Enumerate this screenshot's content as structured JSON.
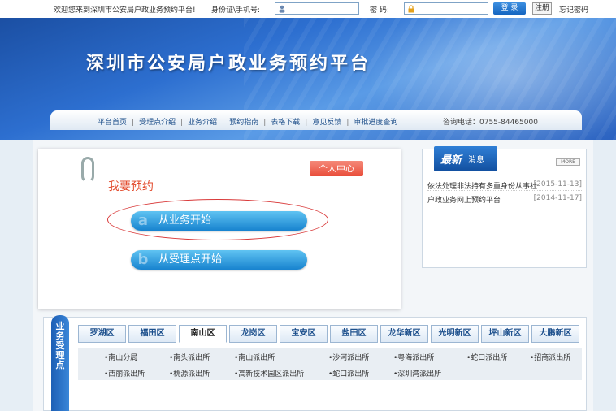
{
  "topbar": {
    "welcome": "欢迎您来到深圳市公安局户政业务预约平台!",
    "id_label": "身份证\\手机号:",
    "id_value": "",
    "password_label": "密  码:",
    "password_value": "",
    "login_label": "登 录",
    "register_label": "注册",
    "forget_label": "忘记密码"
  },
  "banner": {
    "title": "深圳市公安局户政业务预约平台"
  },
  "nav": {
    "items": [
      "平台首页",
      "受理点介绍",
      "业务介绍",
      "预约指南",
      "表格下载",
      "意见反馈",
      "审批进度查询"
    ],
    "phone": "咨询电话：0755-84465000"
  },
  "booking": {
    "personal_center": "个人中心",
    "heading": "我要预约",
    "by_business": {
      "glyph": "a",
      "label": "从业务开始"
    },
    "by_station": {
      "glyph": "b",
      "label": "从受理点开始"
    }
  },
  "news": {
    "badge_big": "最新",
    "badge_small": "消息",
    "more": "MORE",
    "items": [
      {
        "title": "依法处理非法持有多重身份从事社...",
        "date": "[2015-11-13]"
      },
      {
        "title": "户政业务网上预约平台",
        "date": "[2014-11-17]"
      }
    ]
  },
  "districts": {
    "side_label": "业务受理点",
    "tabs": [
      "罗湖区",
      "福田区",
      "南山区",
      "龙岗区",
      "宝安区",
      "盐田区",
      "龙华新区",
      "光明新区",
      "坪山新区",
      "大鹏新区"
    ],
    "active_index": 2,
    "stations_row1": [
      "南山分局",
      "南头派出所",
      "南山派出所",
      "沙河派出所",
      "粤海派出所",
      "蛇口派出所",
      "招商派出所"
    ],
    "stations_row2": [
      "西丽派出所",
      "桃源派出所",
      "高新技术园区派出所",
      "蛇口派出所",
      "深圳湾派出所"
    ]
  },
  "colors": {
    "accent": "#1783cf",
    "brand": "#1b4fa3",
    "alert": "#e94d3a"
  },
  "icons": {
    "user": "user-icon",
    "lock": "lock-icon"
  }
}
